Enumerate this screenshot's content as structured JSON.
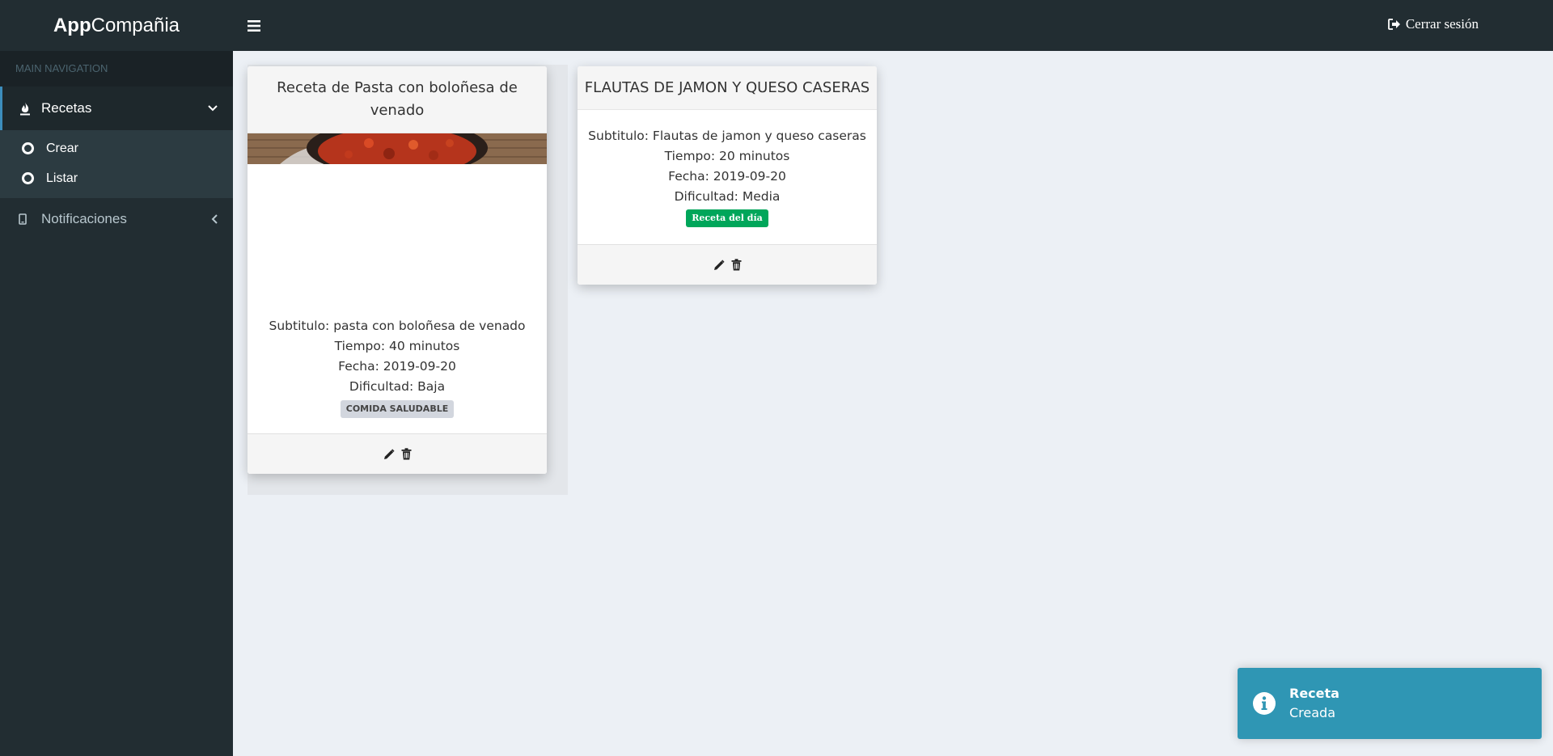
{
  "header": {
    "logo_bold": "App",
    "logo_rest": "Compañia",
    "logout_label": "Cerrar sesión"
  },
  "sidebar": {
    "section_title": "MAIN NAVIGATION",
    "items": [
      {
        "label": "Recetas",
        "icon": "fire-icon",
        "expanded": true,
        "children": [
          {
            "label": "Crear"
          },
          {
            "label": "Listar"
          }
        ]
      },
      {
        "label": "Notificaciones",
        "icon": "mobile-icon",
        "expanded": false
      }
    ]
  },
  "cards": [
    {
      "title": "Receta de Pasta con boloñesa de venado",
      "subtitle": "Subtitulo: pasta con boloñesa de venado",
      "tiempo": "Tiempo: 40 minutos",
      "fecha": "Fecha: 2019-09-20",
      "dificultad": "Dificultad: Baja",
      "badge": "COMIDA SALUDABLE",
      "has_image": true
    },
    {
      "title": "FLAUTAS DE JAMON Y QUESO CASERAS",
      "subtitle": "Subtitulo: Flautas de jamon y queso caseras",
      "tiempo": "Tiempo: 20 minutos",
      "fecha": "Fecha: 2019-09-20",
      "dificultad": "Dificultad: Media",
      "badge": "Receta del día",
      "has_image": false
    }
  ],
  "toast": {
    "title": "Receta",
    "message": "Creada",
    "color": "#2f96b4"
  },
  "colors": {
    "sidebar_bg": "#222d32",
    "content_bg": "#ecf0f5",
    "badge_green": "#00a65a",
    "badge_gray": "#d2d6de"
  }
}
